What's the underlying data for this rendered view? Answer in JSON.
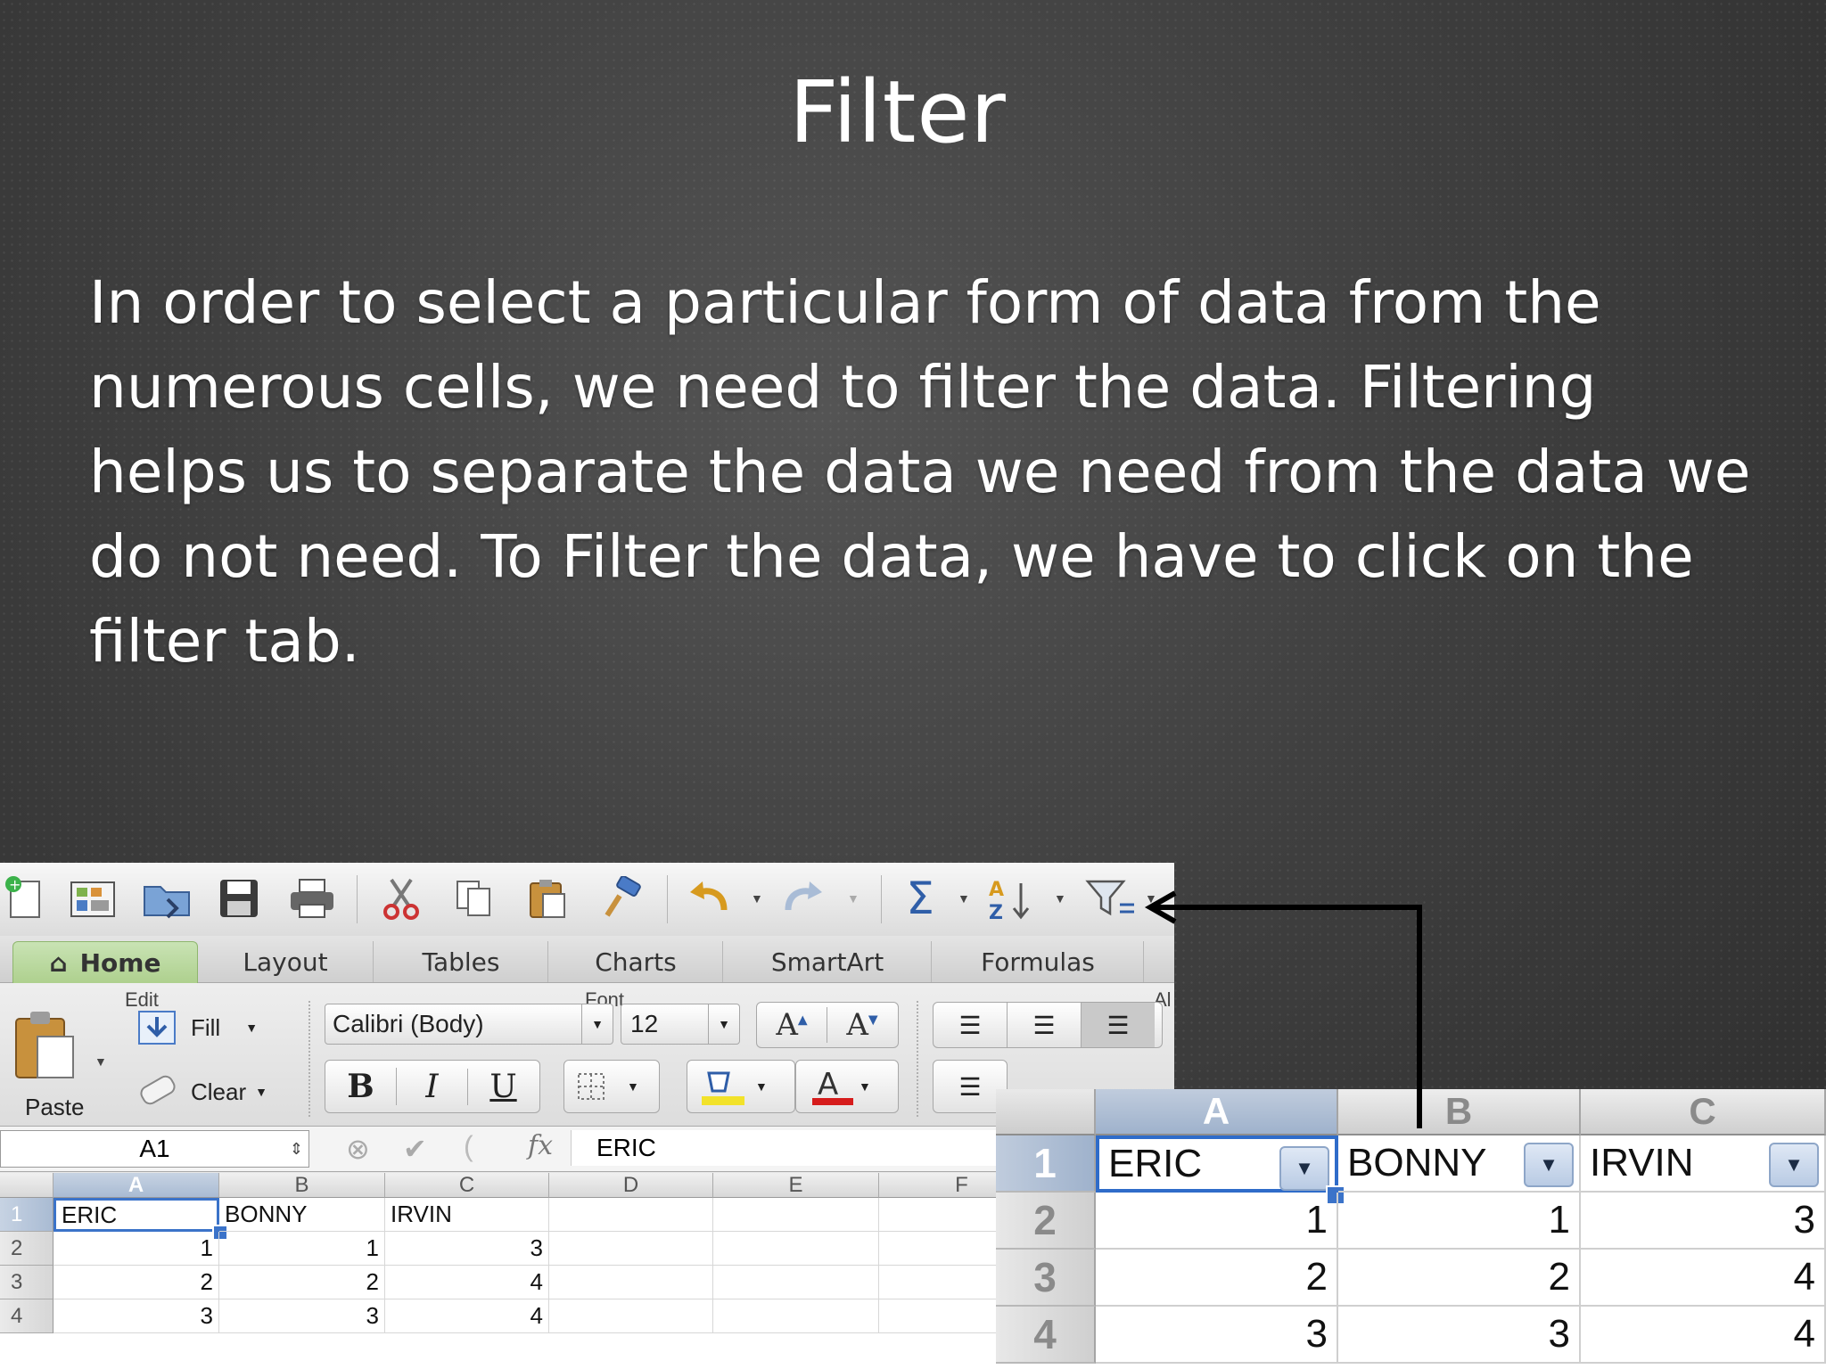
{
  "slide": {
    "title": "Filter",
    "body_lines": [
      "In order to select a particular form of data from the",
      "numerous cells, we need to filter the data. Filtering",
      "helps us to separate the data we need from the data we",
      "do not need. To Filter the data, we have to click on the",
      "filter tab."
    ]
  },
  "toolbar": {
    "icons": [
      "new-icon",
      "gallery-icon",
      "open-icon",
      "save-icon",
      "print-icon",
      "cut-icon",
      "copy-icon",
      "paste-icon",
      "format-painter-icon",
      "undo-icon",
      "redo-icon",
      "autosum-icon",
      "sort-icon",
      "filter-icon"
    ]
  },
  "ribbon_tabs": [
    {
      "label": "Home",
      "active": true
    },
    {
      "label": "Layout",
      "active": false
    },
    {
      "label": "Tables",
      "active": false
    },
    {
      "label": "Charts",
      "active": false
    },
    {
      "label": "SmartArt",
      "active": false
    },
    {
      "label": "Formulas",
      "active": false
    }
  ],
  "ribbon": {
    "edit_group": "Edit",
    "font_group": "Font",
    "alignment_group": "Al",
    "paste_label": "Paste",
    "fill_label": "Fill",
    "clear_label": "Clear",
    "font_name": "Calibri (Body)",
    "font_size": "12",
    "bold": "B",
    "italic": "I",
    "underline": "U",
    "grow_font": "A",
    "shrink_font": "A"
  },
  "formula_bar": {
    "name_box": "A1",
    "fx": "fx",
    "value": "ERIC"
  },
  "small_grid": {
    "columns": [
      "A",
      "B",
      "C",
      "D",
      "E",
      "F"
    ],
    "rows": [
      "1",
      "2",
      "3",
      "4"
    ],
    "cells": [
      [
        "ERIC",
        "BONNY",
        "IRVIN"
      ],
      [
        "1",
        "1",
        "3"
      ],
      [
        "2",
        "2",
        "4"
      ],
      [
        "3",
        "3",
        "4"
      ]
    ]
  },
  "zoom_grid": {
    "columns": [
      "A",
      "B",
      "C"
    ],
    "rows": [
      "1",
      "2",
      "3",
      "4"
    ],
    "cells": [
      [
        "ERIC",
        "BONNY",
        "IRVIN"
      ],
      [
        "1",
        "1",
        "3"
      ],
      [
        "2",
        "2",
        "4"
      ],
      [
        "3",
        "3",
        "4"
      ]
    ]
  },
  "colors": {
    "accent": "#3b73c9",
    "active_tab": "#aed08e",
    "arrow": "#000000"
  }
}
